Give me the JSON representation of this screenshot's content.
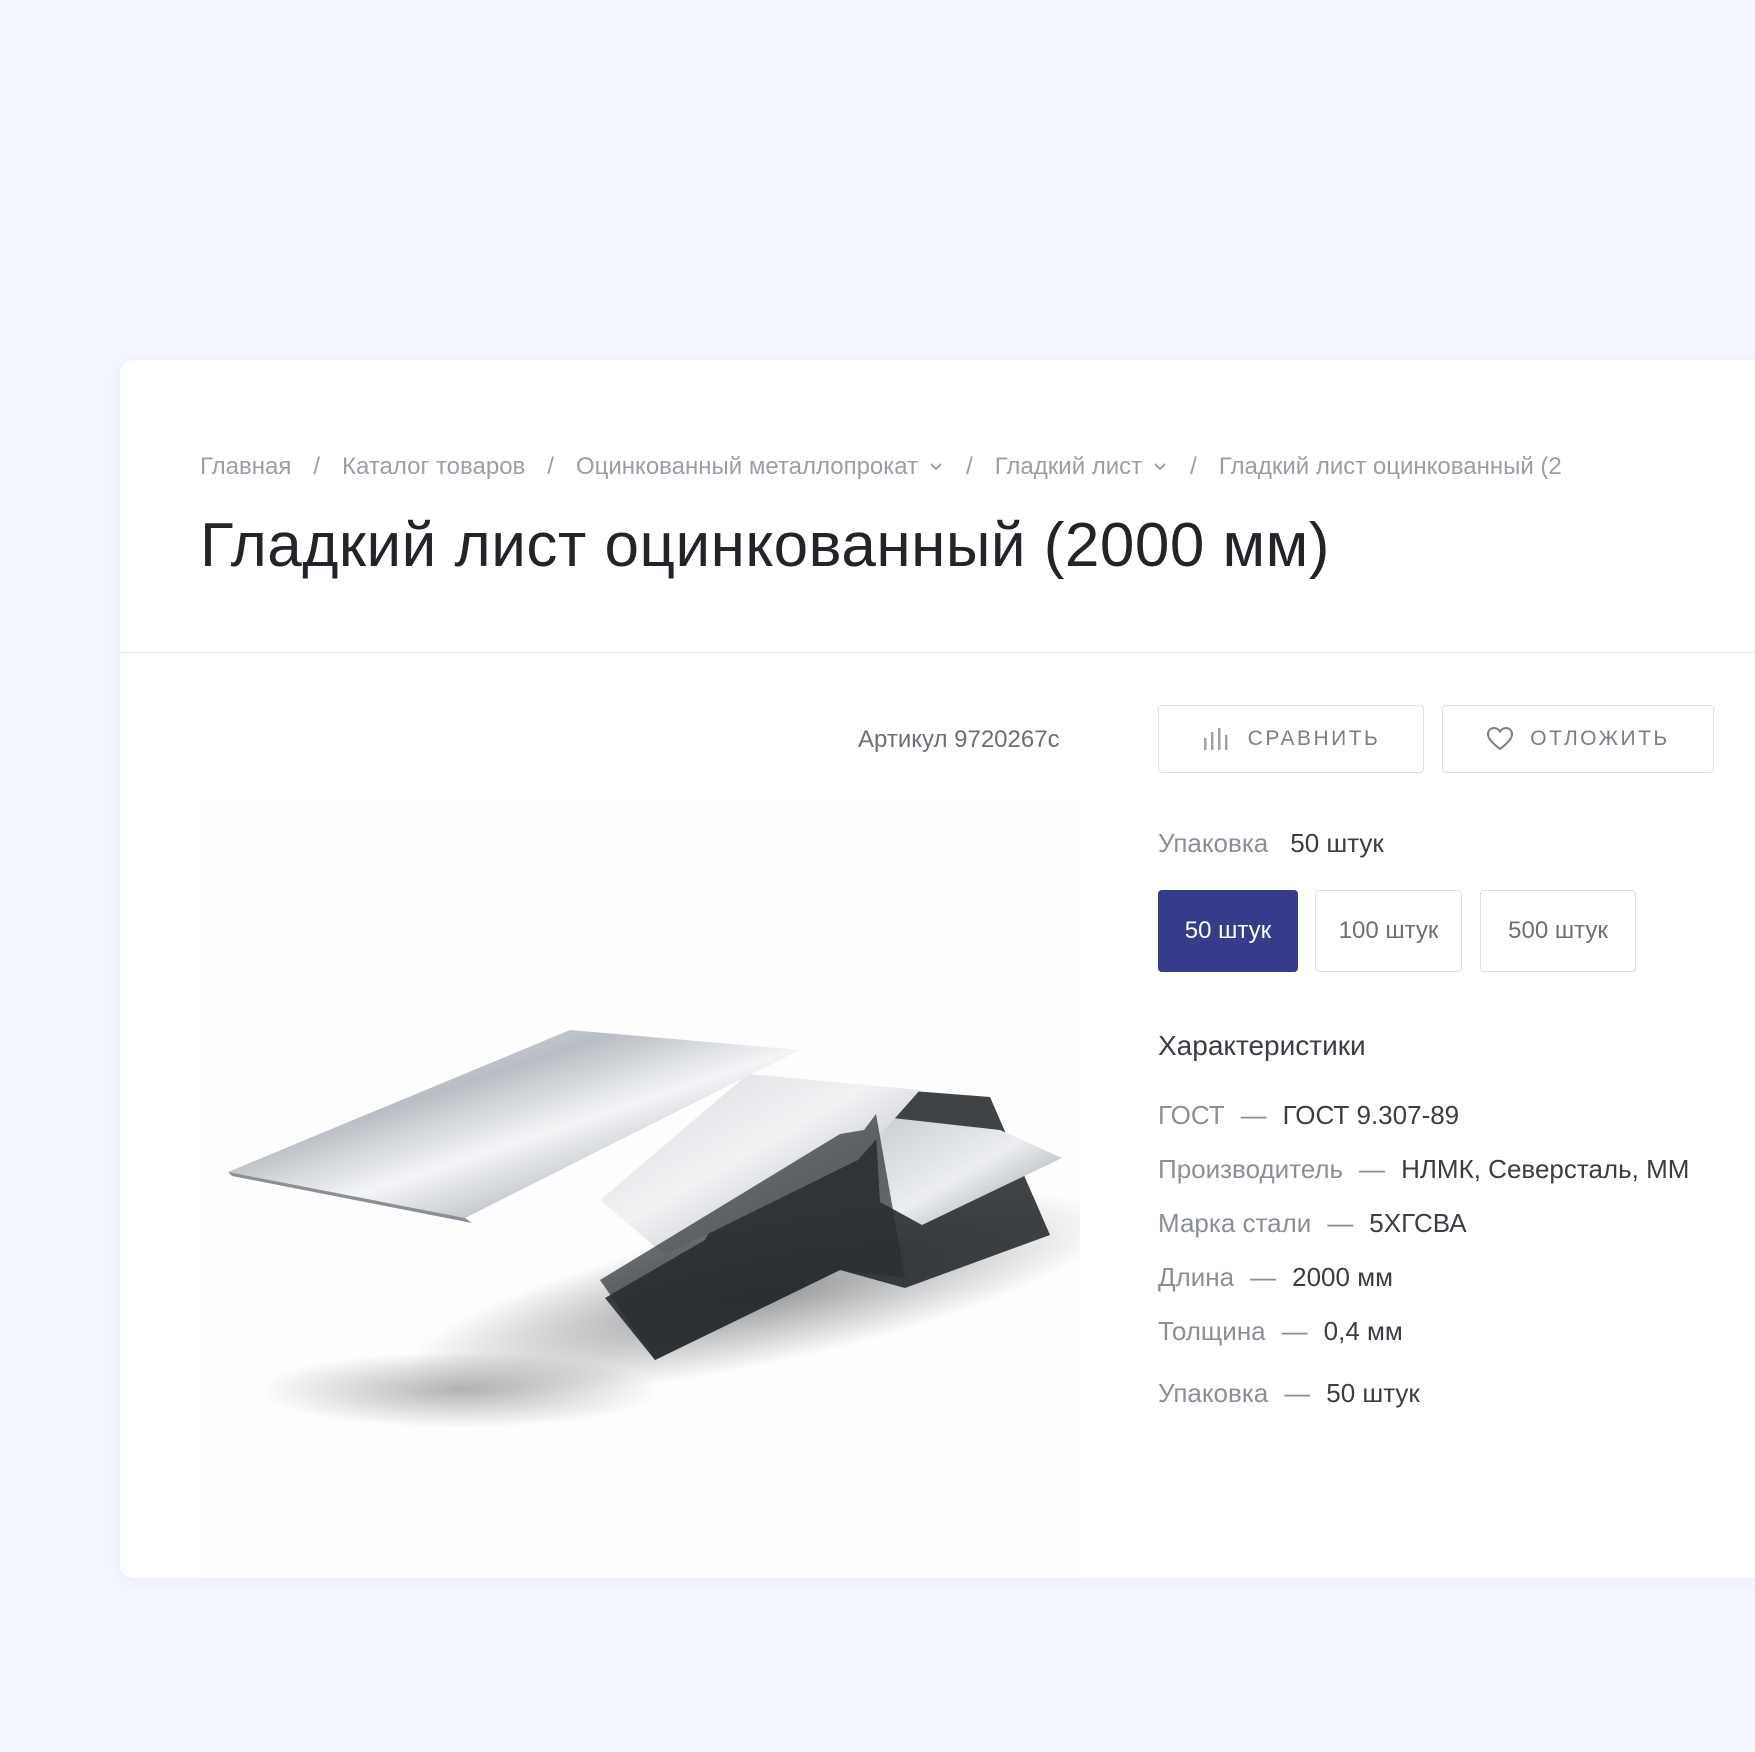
{
  "breadcrumb": {
    "items": [
      {
        "label": "Главная",
        "dropdown": false
      },
      {
        "label": "Каталог товаров",
        "dropdown": false
      },
      {
        "label": "Оцинкованный металлопрокат",
        "dropdown": true
      },
      {
        "label": "Гладкий лист",
        "dropdown": true
      },
      {
        "label": "Гладкий лист оцинкованный (2"
      }
    ],
    "separator": "/"
  },
  "product": {
    "title": "Гладкий лист оцинкованный (2000 мм)",
    "sku": "Артикул 9720267с"
  },
  "actions": {
    "compare_label": "Сравнить",
    "compare_icon": "bar-chart-icon",
    "favorite_label": "Отложить",
    "favorite_icon": "heart-icon"
  },
  "packaging": {
    "label": "Упаковка",
    "selected": "50 штук",
    "options": [
      "50 штук",
      "100 штук",
      "500 штук"
    ]
  },
  "specs": {
    "title": "Характеристики",
    "dash": "—",
    "rows": [
      {
        "label": "ГОСТ",
        "value": "ГОСТ 9.307-89"
      },
      {
        "label": "Производитель",
        "value": "НЛМК, Северсталь, ММ"
      },
      {
        "label": "Марка стали",
        "value": "5ХГСВА"
      },
      {
        "label": "Длина",
        "value": "2000 мм"
      },
      {
        "label": "Толщина",
        "value": "0,4 мм"
      },
      {
        "label": "Упаковка",
        "value": "50 штук"
      }
    ]
  },
  "colors": {
    "page_background": "#f3f6fc",
    "accent": "#363b8c",
    "text_primary": "#22242a",
    "text_muted": "#8b8f98"
  }
}
